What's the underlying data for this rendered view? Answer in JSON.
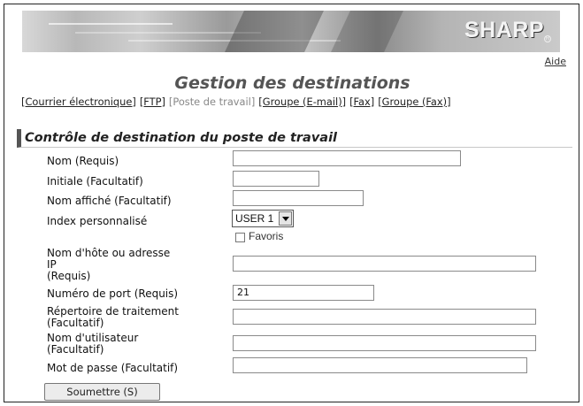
{
  "header": {
    "logo": "SHARP",
    "logo_mark": "R",
    "help_link": "Aide"
  },
  "page": {
    "title": "Gestion des destinations"
  },
  "tabs": [
    {
      "label": "[Courrier électronique]",
      "current": false
    },
    {
      "label": "[FTP]",
      "current": false
    },
    {
      "label": "[Poste de travail]",
      "current": true
    },
    {
      "label": "[Groupe (E-mail)]",
      "current": false
    },
    {
      "label": "[Fax]",
      "current": false
    },
    {
      "label": "[Groupe (Fax)]",
      "current": false
    }
  ],
  "form": {
    "section_title": "Contrôle de destination du poste de travail",
    "fields": {
      "name": {
        "label": "Nom (Requis)",
        "value": ""
      },
      "initial": {
        "label": "Initiale (Facultatif)",
        "value": ""
      },
      "display_name": {
        "label": "Nom affiché (Facultatif)",
        "value": ""
      },
      "custom_index": {
        "label": "Index personnalisé",
        "value": "USER 1"
      },
      "favorites": {
        "label": "Favoris",
        "checked": false
      },
      "host": {
        "label_line1": "Nom d'hôte ou adresse",
        "label_line2": "IP",
        "label_line3": "(Requis)",
        "value": ""
      },
      "port": {
        "label": "Numéro de port (Requis)",
        "value": "21"
      },
      "directory": {
        "label_line1": "Répertoire de traitement",
        "label_line2": "(Facultatif)",
        "value": ""
      },
      "username": {
        "label_line1": "Nom d'utilisateur",
        "label_line2": "(Facultatif)",
        "value": ""
      },
      "password": {
        "label": "Mot de passe (Facultatif)",
        "value": ""
      }
    },
    "submit_label": "Soumettre (S)"
  },
  "colors": {
    "title": "#555555",
    "section_bar": "#555555",
    "inactive_tab": "#888888"
  }
}
